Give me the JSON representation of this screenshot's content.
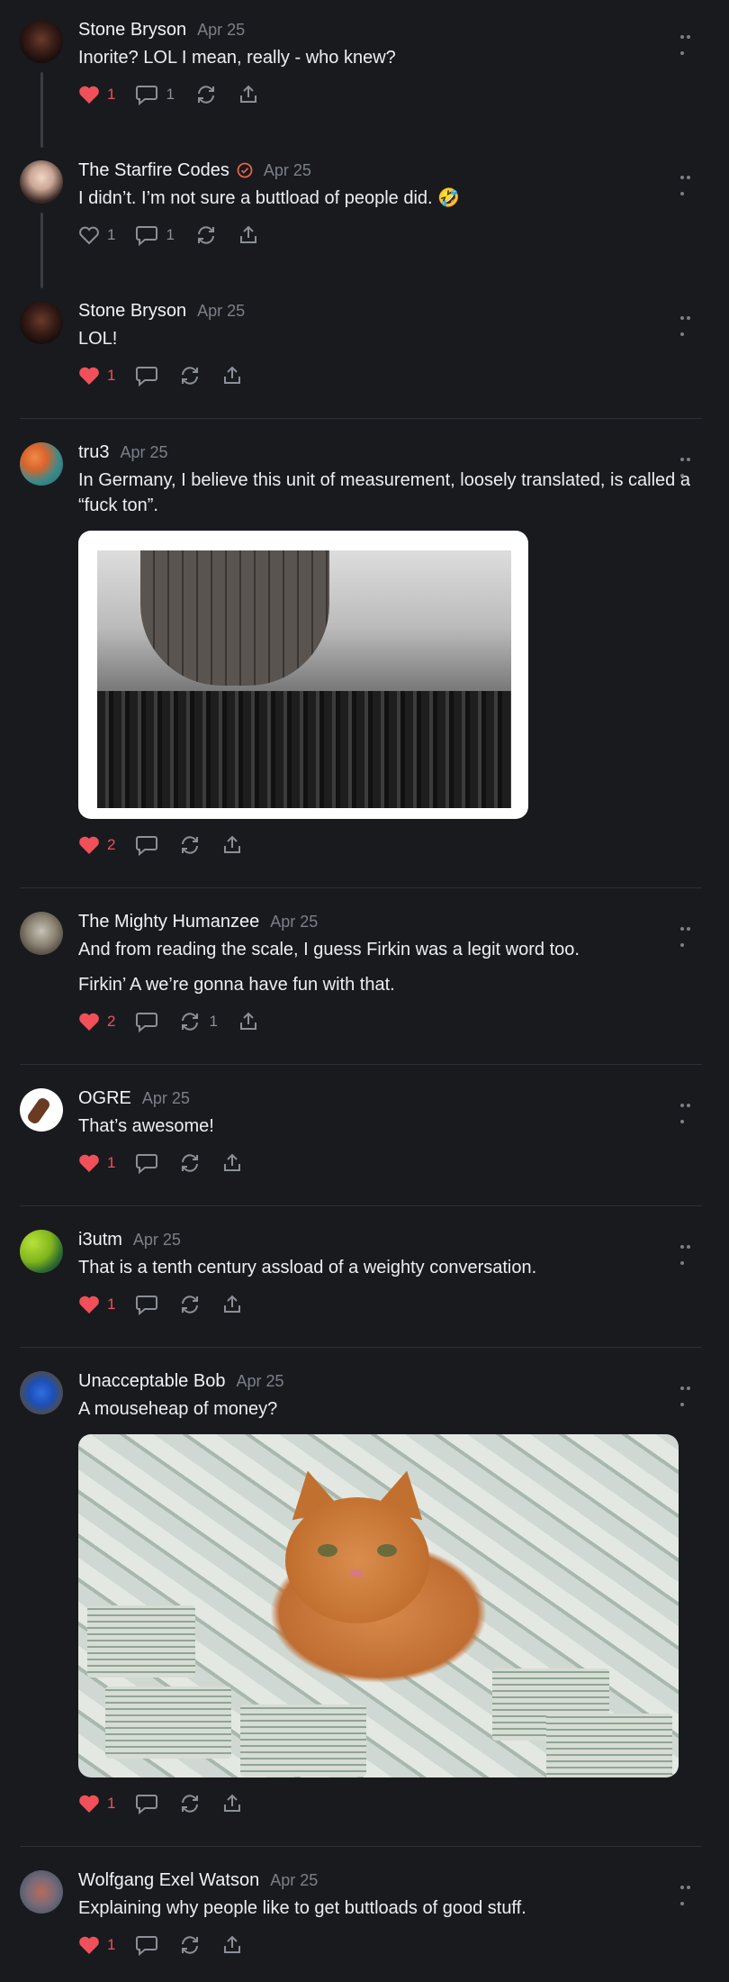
{
  "colors": {
    "background": "#181a1e",
    "like": "#f0505a",
    "muted": "#8b8f97",
    "verified": "#e2634a"
  },
  "posts": [
    {
      "name": "Stone Bryson",
      "date": "Apr 25",
      "text": "Inorite? LOL I mean, really - who knew?",
      "likes": "1",
      "replies": "1",
      "liked": true
    },
    {
      "name": "The Starfire Codes",
      "date": "Apr 25",
      "text": "I didn’t. I’m not sure a buttload of people did. 🤣",
      "likes": "1",
      "replies": "1",
      "liked": false,
      "verified": true
    },
    {
      "name": "Stone Bryson",
      "date": "Apr 25",
      "text": "LOL!",
      "likes": "1",
      "liked": true
    },
    {
      "name": "tru3",
      "date": "Apr 25",
      "text": "In Germany, I believe this unit of measurement, loosely translated, is called a “fuck ton”.",
      "likes": "2",
      "liked": true,
      "image": "black-and-white photo of a crowd in front of a giant wooden barrel"
    },
    {
      "name": "The Mighty Humanzee",
      "date": "Apr 25",
      "text": "And from reading the scale, I guess Firkin was a legit word too.",
      "text2": "Firkin’ A we’re gonna have fun with that.",
      "likes": "2",
      "reposts": "1",
      "liked": true
    },
    {
      "name": "OGRE",
      "date": "Apr 25",
      "text": "That’s awesome!",
      "likes": "1",
      "liked": true
    },
    {
      "name": "i3utm",
      "date": "Apr 25",
      "text": "That is a tenth century assload of a weighty conversation.",
      "likes": "1",
      "liked": true
    },
    {
      "name": "Unacceptable Bob",
      "date": "Apr 25",
      "text": "A mouseheap of money?",
      "likes": "1",
      "liked": true,
      "image": "orange cat lying on piles of dollar bills"
    },
    {
      "name": "Wolfgang Exel Watson",
      "date": "Apr 25",
      "text": "Explaining why people like to get buttloads of good stuff.",
      "likes": "1",
      "liked": true
    }
  ]
}
